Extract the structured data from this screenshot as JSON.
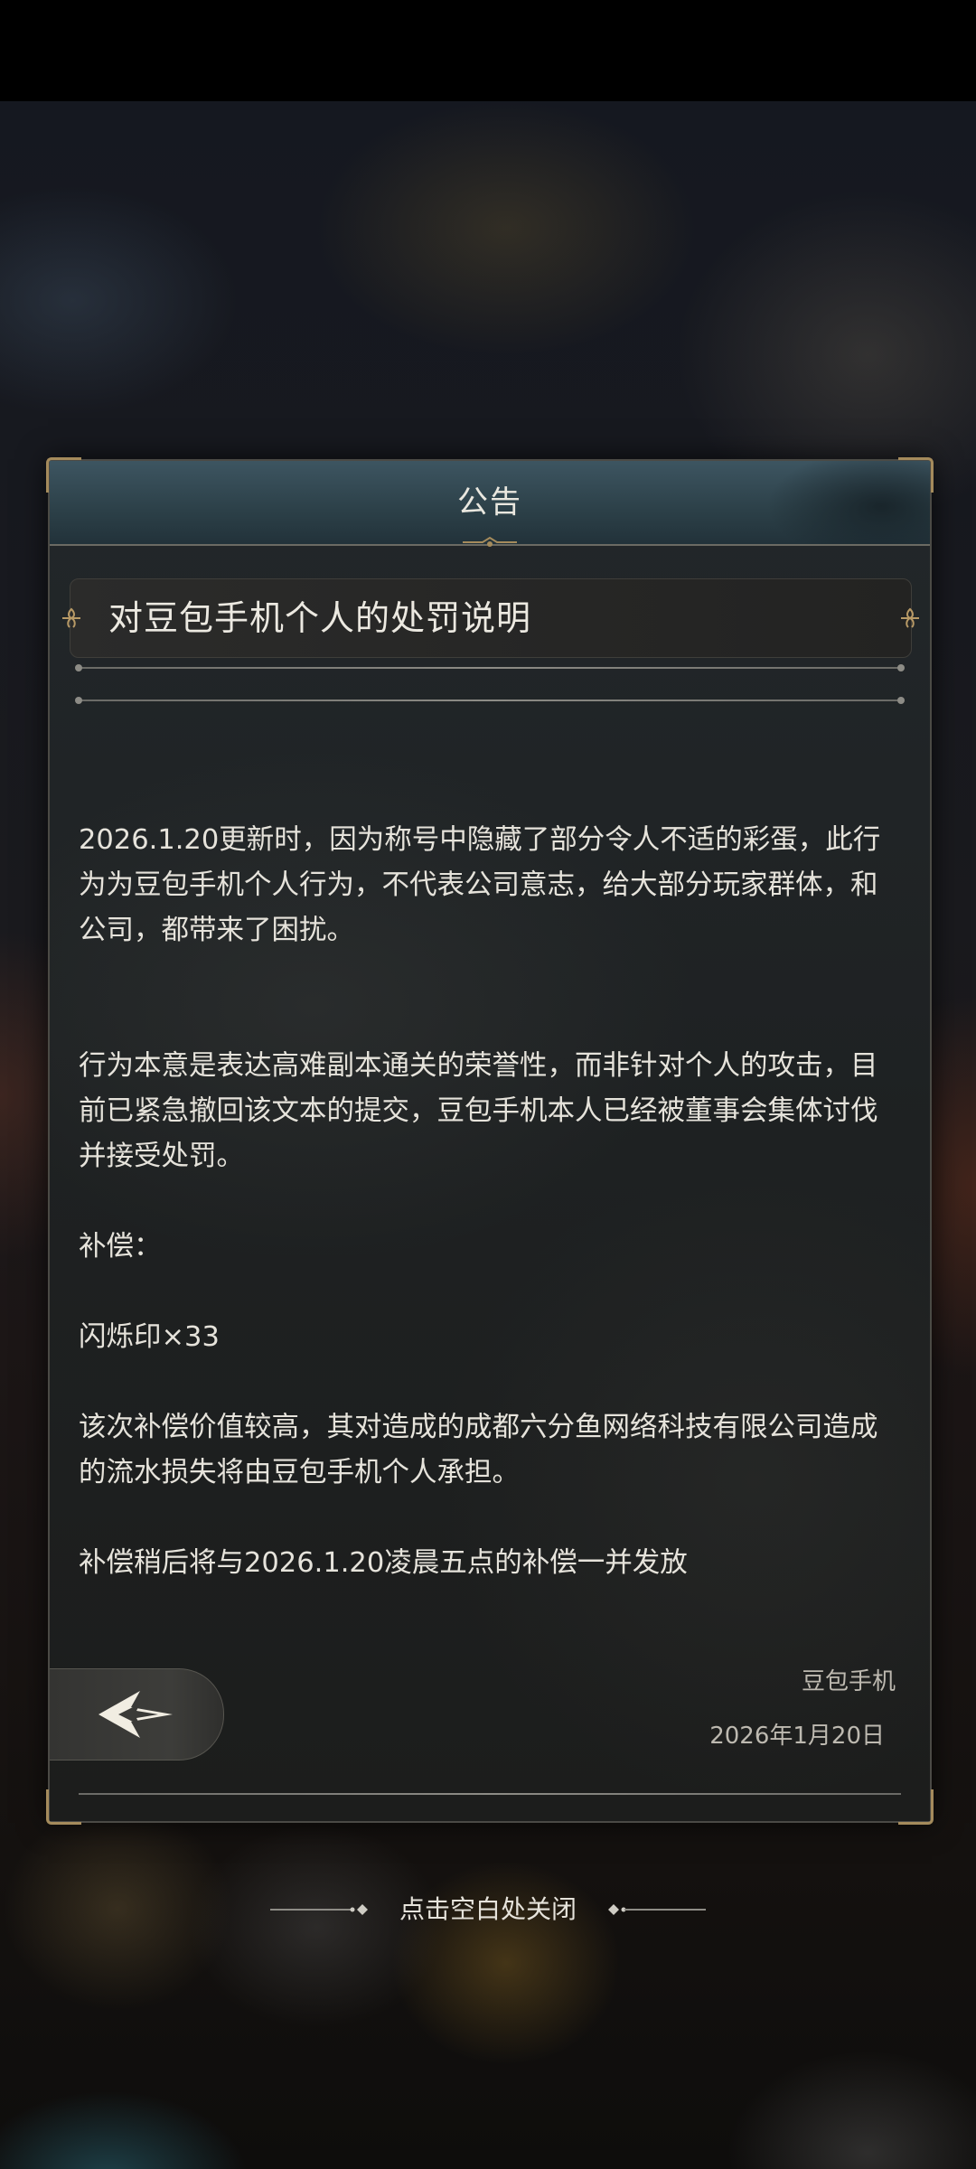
{
  "dialog": {
    "header_title": "公告",
    "notice_title": "对豆包手机个人的处罚说明",
    "paragraphs": {
      "p1": "2026.1.20更新时，因为称号中隐藏了部分令人不适的彩蛋，此行为为豆包手机个人行为，不代表公司意志，给大部分玩家群体，和公司，都带来了困扰。",
      "p2": "行为本意是表达高难副本通关的荣誉性，而非针对个人的攻击，目前已紧急撤回该文本的提交，豆包手机本人已经被董事会集体讨伐并接受处罚。",
      "p3": "补偿：",
      "p4": "闪烁印×33",
      "p5": "该次补偿价值较高，其对造成的成都六分鱼网络科技有限公司造成的流水损失将由豆包手机个人承担。",
      "p6": "补偿稍后将与2026.1.20凌晨五点的补偿一并发放"
    },
    "signature": "豆包手机",
    "date": "2026年1月20日",
    "back_icon": "back-arrow-icon"
  },
  "close_hint": "点击空白处关闭",
  "colors": {
    "header_bg": "#2c4048",
    "panel_bg": "#1e2122",
    "gold_accent": "#a58b5c",
    "text": "#e6e3db"
  }
}
